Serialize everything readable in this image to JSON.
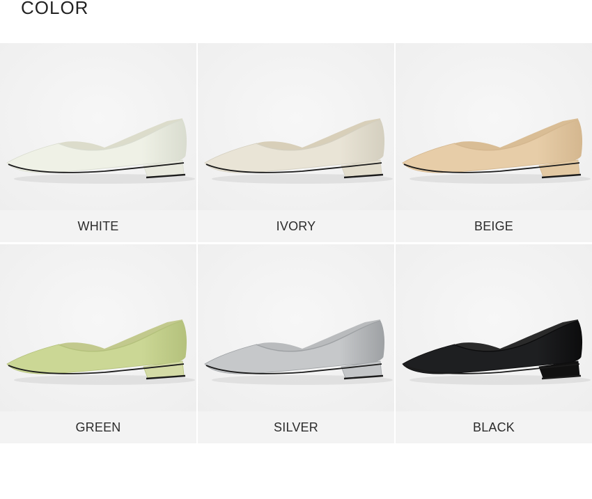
{
  "section": {
    "title": "COLOR"
  },
  "colors": [
    {
      "label": "WHITE",
      "upper": "#eff1e6",
      "shade": "#d9dccf",
      "lining": "#dcdccb",
      "heel": "#e8e9de"
    },
    {
      "label": "IVORY",
      "upper": "#e9e4d6",
      "shade": "#d4cfbf",
      "lining": "#d8cfb9",
      "heel": "#e2ddcd"
    },
    {
      "label": "BEIGE",
      "upper": "#e7cda8",
      "shade": "#d4b78f",
      "lining": "#d9bd95",
      "heel": "#e3c9a3"
    },
    {
      "label": "GREEN",
      "upper": "#cbd795",
      "shade": "#b4c17c",
      "lining": "#c2c98d",
      "heel": "#d4dba6"
    },
    {
      "label": "SILVER",
      "upper": "#c6c8ca",
      "shade": "#9ea1a4",
      "lining": "#b9bbbd",
      "heel": "#c4c6c8"
    },
    {
      "label": "BLACK",
      "upper": "#1e1f21",
      "shade": "#0c0c0d",
      "lining": "#2a2a2a",
      "heel": "#111111"
    }
  ]
}
